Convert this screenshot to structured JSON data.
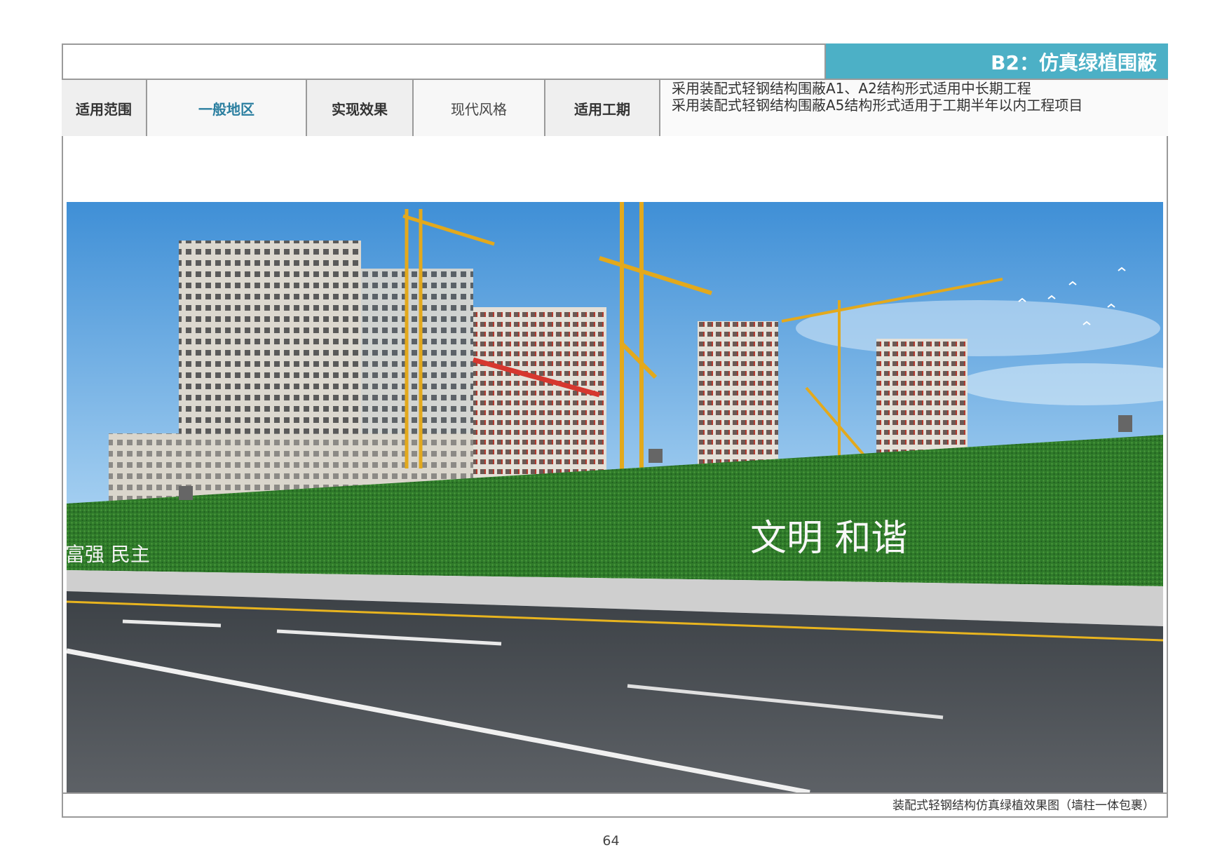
{
  "header": {
    "title": "B2：仿真绿植围蔽"
  },
  "info_row": {
    "scope_label": "适用范围",
    "scope_value": "一般地区",
    "effect_label": "实现效果",
    "effect_value": "现代风格",
    "period_label": "适用工期",
    "period_notes": [
      "采用装配式轻钢结构围蔽A1、A2结构形式适用中长期工程",
      "采用装配式轻钢结构围蔽A5结构形式适用于工期半年以内工程项目"
    ]
  },
  "image": {
    "wall_slogan_left": "富强  民主",
    "wall_slogan_right": "文明  和谐"
  },
  "caption": "装配式轻钢结构仿真绿植效果图（墙柱一体包裹）",
  "page_number": "64",
  "colors": {
    "title_bar": "#4cb0c6",
    "accent_text": "#2b7fa0",
    "border": "#9a9a9a",
    "grass": "#2f7a2a",
    "sky": "#5aa6e0"
  }
}
